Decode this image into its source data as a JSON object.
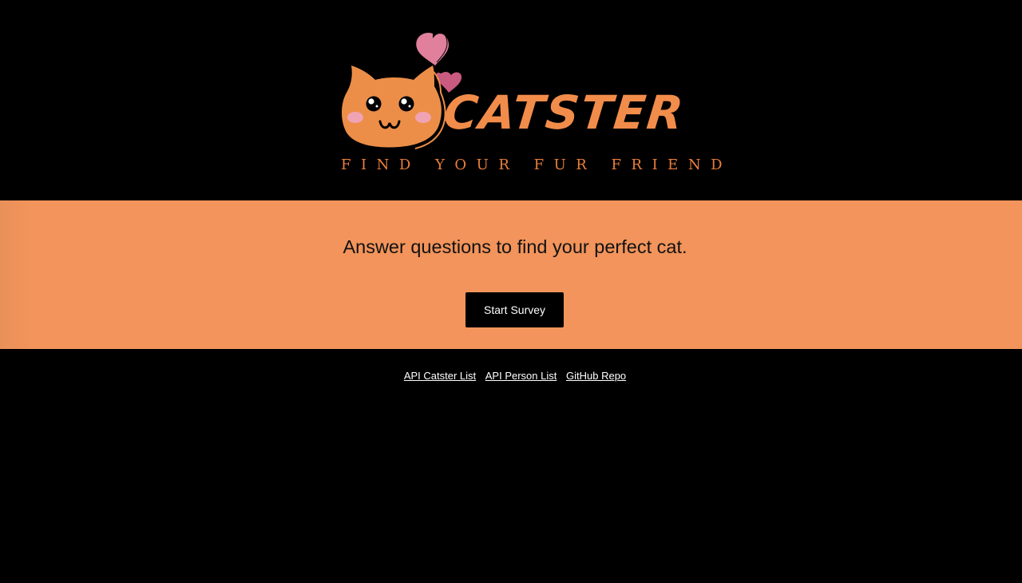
{
  "brand": {
    "name": "CATSTER",
    "tagline": "FIND YOUR FUR FRIEND",
    "logo_icon": "cat-face-with-hearts",
    "colors": {
      "orange": "#f2945b",
      "cat_orange": "#ec8e48",
      "heart_pink": "#e0809c",
      "heart_dark_pink": "#c95a80",
      "background": "#000000"
    }
  },
  "hero": {
    "headline": "Answer questions to find your perfect cat.",
    "start_button_label": "Start Survey"
  },
  "footer": {
    "links": [
      {
        "label": "API Catster List"
      },
      {
        "label": "API Person List"
      },
      {
        "label": "GitHub Repo"
      }
    ]
  }
}
